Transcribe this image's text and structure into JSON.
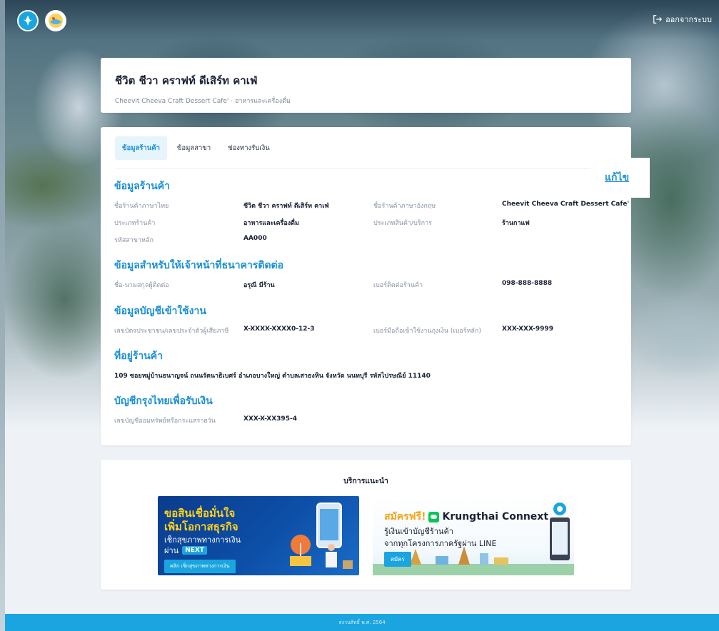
{
  "header": {
    "logout_label": "ออกจากระบบ"
  },
  "shop": {
    "name_th": "ชีวิต ชีวา คราฟท์ ดีเสิร์ท คาเฟ่",
    "subtitle": "Cheevit Cheeva Craft Dessert Cafe' · อาหารและเครื่องดื่ม"
  },
  "tabs": [
    {
      "label": "ข้อมูลร้านค้า",
      "active": true
    },
    {
      "label": "ข้อมูลสาขา",
      "active": false
    },
    {
      "label": "ช่องทางรับเงิน",
      "active": false
    }
  ],
  "edit_label": "แก้ไข",
  "sections": {
    "shop_info": {
      "title": "ข้อมูลร้านค้า",
      "name_th_label": "ชื่อร้านค้าภาษาไทย",
      "name_th_value": "ชีวิต ชีวา คราฟท์ ดีเสิร์ท คาเฟ่",
      "name_en_label": "ชื่อร้านค้าภาษาอังกฤษ",
      "name_en_value": "Cheevit Cheeva Craft Dessert Cafe'",
      "type_label": "ประเภทร้านค้า",
      "type_value": "อาหารและเครื่องดื่ม",
      "product_label": "ประเภทสินค้า/บริการ",
      "product_value": "ร้านกาแฟ",
      "branch_code_label": "รหัสสาขาหลัก",
      "branch_code_value": "AA000"
    },
    "contact": {
      "title": "ข้อมูลสำหรับให้เจ้าหน้าที่ธนาคารติดต่อ",
      "name_label": "ชื่อ-นามสกุลผู้ติดต่อ",
      "name_value": "อรุณี มีร้าน",
      "phone_label": "เบอร์ติดต่อร้านค้า",
      "phone_value": "098-888-8888"
    },
    "account": {
      "title": "ข้อมูลบัญชีเข้าใช้งาน",
      "id_label": "เลขบัตรประชาชน/เลขประจำตัวผู้เสียภาษี",
      "id_value": "X-XXXX-XXXX0-12-3",
      "mobile_label": "เบอร์มือถือเข้าใช้งานถุงเงิน (เบอร์หลัก)",
      "mobile_value": "XXX-XXX-9999"
    },
    "address": {
      "title": "ที่อยู่ร้านค้า",
      "value": "109 ซอยหมู่บ้านธนาญจน์ ถนนรัตนาธิเบศร์ อำเภอบางใหญ่ ตำบลเสาธงหิน จังหวัด นนทบุรี รหัสไปรษณีย์ 11140"
    },
    "bank": {
      "title": "บัญชีกรุงไทยเพื่อรับเงิน",
      "acc_label": "เลขบัญชีออมทรัพย์หรือกระแสรายวัน",
      "acc_value": "XXX-X-XX395-4"
    }
  },
  "promo": {
    "title": "บริการแนะนำ",
    "banner1": {
      "line1": "ขอสินเชื่อมั่นใจ",
      "line2": "เพิ่มโอกาสธุรกิจ",
      "line3": "เช็กสุขภาพทางการเงิน",
      "line4": "ผ่าน",
      "badge": "NEXT",
      "button": "คลิก เช็กสุขภาพทางการเงิน"
    },
    "banner2": {
      "free": "สมัครฟรี!",
      "brand": "Krungthai Connext",
      "line1": "รู้เงินเข้าบัญชีร้านค้า",
      "line2": "จากทุกโครงการภาครัฐผ่าน LINE",
      "button": "สมัคร"
    }
  },
  "footer": {
    "text": "สงวนสิทธิ์ พ.ศ. 2564"
  },
  "colors": {
    "accent": "#1a8fd6",
    "brand": "#1ba5e0"
  }
}
